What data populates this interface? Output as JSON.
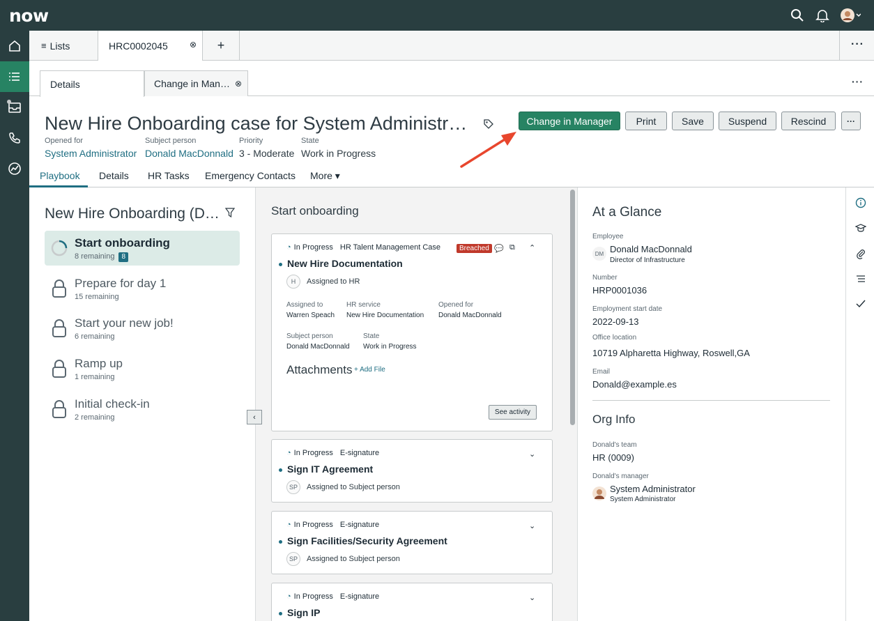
{
  "header": {
    "logo": "now",
    "icons": [
      "search-icon",
      "bell-icon",
      "avatar"
    ],
    "colors": {
      "header_bg": "#293e40",
      "accent": "#278363",
      "link": "#1f6e82",
      "breached": "#c0392b"
    }
  },
  "rail": {
    "items": [
      "home-icon",
      "list-icon",
      "inbox-icon",
      "phone-icon",
      "analytics-icon"
    ]
  },
  "tabs": {
    "lists_label": "Lists",
    "record_tab_label": "HRC0002045",
    "add_label": "+",
    "more_label": "···"
  },
  "subtabs": {
    "details_label": "Details",
    "change_label": "Change in Man…",
    "more_label": "···"
  },
  "record": {
    "title": "New Hire Onboarding case for System Administr…",
    "fields": [
      {
        "label": "Opened for",
        "value": "System Administrator"
      },
      {
        "label": "Subject person",
        "value": "Donald MacDonnald"
      },
      {
        "label": "Priority",
        "value": "3 - Moderate"
      },
      {
        "label": "State",
        "value": "Work in Progress"
      }
    ],
    "buttons": {
      "change_manager": "Change in Manager",
      "print": "Print",
      "save": "Save",
      "suspend": "Suspend",
      "rescind": "Rescind",
      "more": "···"
    }
  },
  "navtabs": {
    "playbook": "Playbook",
    "details": "Details",
    "hr_tasks": "HR Tasks",
    "emergency": "Emergency Contacts",
    "more": "More ▾"
  },
  "playbook": {
    "title": "New Hire Onboarding (D…",
    "stages": [
      {
        "title": "Start onboarding",
        "sub": "8 remaining",
        "badge": "8"
      },
      {
        "title": "Prepare for day 1",
        "sub": "15 remaining"
      },
      {
        "title": "Start your new job!",
        "sub": "6 remaining"
      },
      {
        "title": "Ramp up",
        "sub": "1 remaining"
      },
      {
        "title": "Initial check-in",
        "sub": "2 remaining"
      }
    ]
  },
  "onboarding": {
    "title": "Start onboarding",
    "cards": [
      {
        "status": "In Progress",
        "type": "HR Talent Management Case",
        "badge": "Breached",
        "title": "New Hire Documentation",
        "initials": "H",
        "assigned_text": "Assigned to HR",
        "assigned_to_label": "Assigned to",
        "assigned_to": "Warren Speach",
        "hr_service_label": "HR service",
        "hr_service": "New Hire Documentation",
        "opened_for_label": "Opened for",
        "opened_for": "Donald MacDonnald",
        "subject_label": "Subject person",
        "subject": "Donald MacDonnald",
        "state_label": "State",
        "state": "Work in Progress",
        "attachments": "Attachments",
        "add_file": "+ Add File",
        "see_activity": "See activity"
      },
      {
        "status": "In Progress",
        "type": "E-signature",
        "title": "Sign IT Agreement",
        "initials": "SP",
        "assigned_text": "Assigned to Subject person"
      },
      {
        "status": "In Progress",
        "type": "E-signature",
        "title": "Sign Facilities/Security Agreement",
        "initials": "SP",
        "assigned_text": "Assigned to Subject person"
      },
      {
        "status": "In Progress",
        "type": "E-signature",
        "title": "Sign IP"
      }
    ]
  },
  "glance": {
    "title": "At a Glance",
    "employee_label": "Employee",
    "employee_initials": "DM",
    "employee_name": "Donald MacDonnald",
    "employee_title": "Director of Infrastructure",
    "number_label": "Number",
    "number": "HRP0001036",
    "start_label": "Employment start date",
    "start": "2022-09-13",
    "office_label": "Office location",
    "office": "10719 Alpharetta Highway, Roswell,GA",
    "email_label": "Email",
    "email": "Donald@example.es",
    "org_title": "Org Info",
    "team_label": "Donald's team",
    "team": "HR (0009)",
    "manager_label": "Donald's manager",
    "manager_name": "System Administrator",
    "manager_title": "System Administrator"
  },
  "right_sidebar": {
    "icons": [
      "info-icon",
      "graduation-cap-icon",
      "paperclip-icon",
      "list-icon",
      "check-icon"
    ]
  }
}
